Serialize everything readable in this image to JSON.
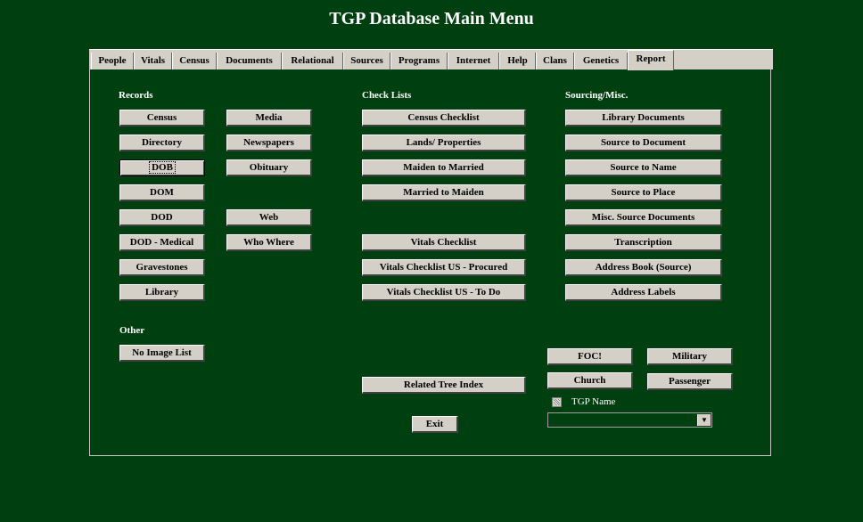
{
  "window": {
    "title": "TGP Database Main Menu"
  },
  "tabs": [
    "People",
    "Vitals",
    "Census",
    "Documents",
    "Relational",
    "Sources",
    "Programs",
    "Internet",
    "Help",
    "Clans",
    "Genetics",
    "Report"
  ],
  "records": {
    "label": "Records",
    "col1": [
      "Census",
      "Directory",
      "DOB",
      "DOM",
      "DOD",
      "DOD - Medical",
      "Gravestones",
      "Library"
    ],
    "col2": [
      "Media",
      "Newspapers",
      "Obituary",
      "Web",
      "Who Where"
    ]
  },
  "checklists": {
    "label": "Check Lists",
    "items": [
      "Census Checklist",
      "Lands/ Properties",
      "Maiden to Married",
      "Married to Maiden",
      "Vitals Checklist",
      "Vitals Checklist US - Procured",
      "Vitals Checklist US - To Do"
    ],
    "related_tree_index": "Related Tree Index",
    "exit": "Exit"
  },
  "sourcing": {
    "label": "Sourcing/Misc.",
    "items": [
      "Library Documents",
      "Source to Document",
      "Source to Name",
      "Source to Place",
      "Misc. Source Documents",
      "Transcription",
      "Address Book (Source)",
      "Address Labels"
    ]
  },
  "other": {
    "label": "Other",
    "no_image_list": "No Image List"
  },
  "bottom_right": {
    "foc": "FOC!",
    "military": "Military",
    "church": "Church",
    "passenger": "Passenger",
    "tgp_name_label": "TGP Name",
    "combo_value": ""
  },
  "colors": {
    "background": "#003f0f",
    "button_face": "#d4d0c8",
    "text_light": "#ffffff"
  }
}
